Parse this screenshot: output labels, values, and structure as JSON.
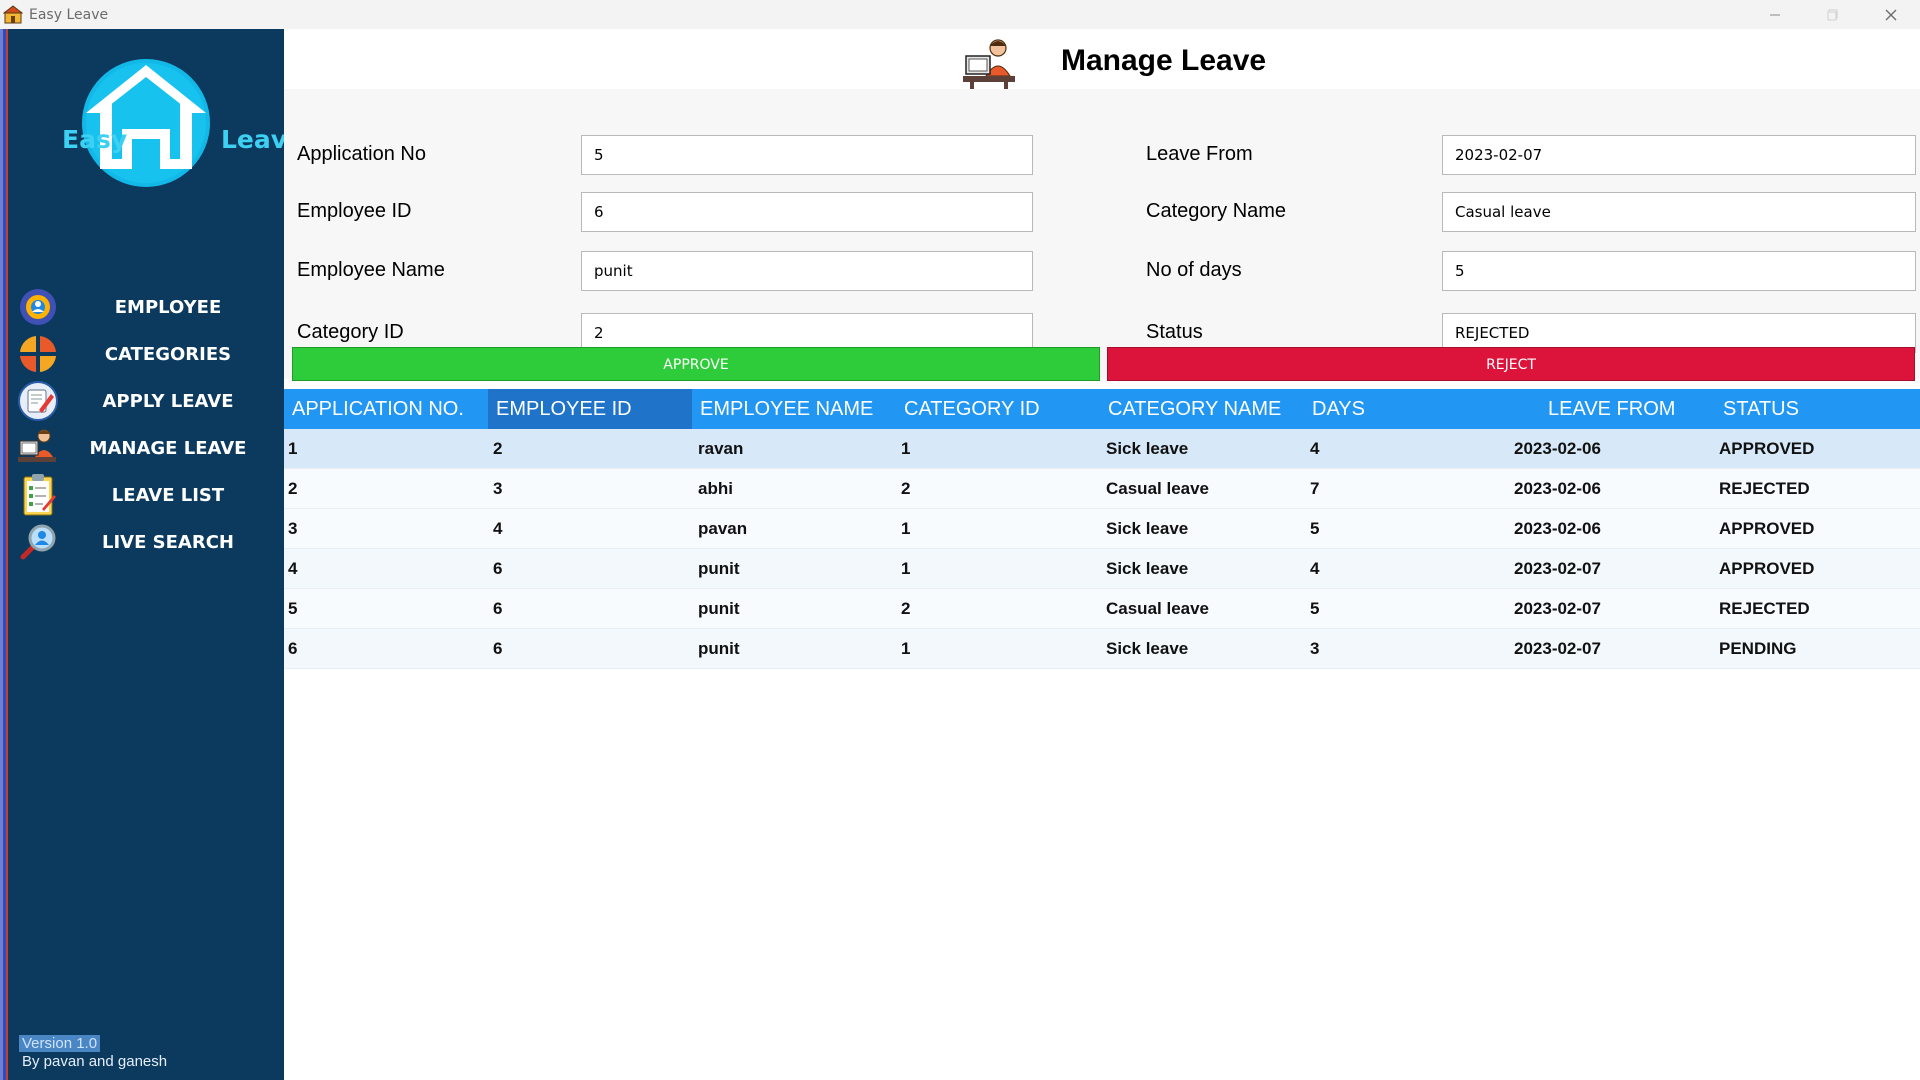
{
  "window": {
    "title": "Easy Leave",
    "controls": [
      "minimize-icon",
      "maximize-icon",
      "close-icon"
    ]
  },
  "sidebar": {
    "logo": {
      "left_text": "Easy",
      "right_text": "Leave",
      "icon": "house-icon",
      "color": "#3dd0f3"
    },
    "items": [
      {
        "label": "EMPLOYEE",
        "icon": "employee-gear-icon"
      },
      {
        "label": "CATEGORIES",
        "icon": "pie-chart-icon"
      },
      {
        "label": "APPLY LEAVE",
        "icon": "edit-document-icon"
      },
      {
        "label": "MANAGE LEAVE",
        "icon": "person-at-computer-icon"
      },
      {
        "label": "LEAVE LIST",
        "icon": "clipboard-list-icon"
      },
      {
        "label": "LIVE SEARCH",
        "icon": "magnifier-user-icon"
      }
    ],
    "version": "Version 1.0",
    "byline": "By pavan and ganesh",
    "bg_color": "#0b3a5e"
  },
  "header": {
    "title": "Manage Leave",
    "icon": "person-at-computer-icon"
  },
  "form": {
    "application_no": {
      "label": "Application No",
      "value": "5"
    },
    "employee_id": {
      "label": "Employee ID",
      "value": "6"
    },
    "employee_name": {
      "label": "Employee Name",
      "value": "punit"
    },
    "category_id": {
      "label": "Category ID",
      "value": "2"
    },
    "leave_from": {
      "label": "Leave From",
      "value": "2023-02-07"
    },
    "category_name": {
      "label": "Category Name",
      "value": "Casual leave"
    },
    "no_of_days": {
      "label": "No of days",
      "value": "5"
    },
    "status": {
      "label": "Status",
      "value": "REJECTED"
    }
  },
  "actions": {
    "approve": "APPROVE",
    "reject": "REJECT",
    "approve_color": "#2ecc3a",
    "reject_color": "#dc143c"
  },
  "table": {
    "header_color": "#2196f3",
    "columns": [
      "APPLICATION NO.",
      "EMPLOYEE ID",
      "EMPLOYEE NAME",
      "CATEGORY ID",
      "CATEGORY NAME",
      "DAYS",
      "LEAVE FROM",
      "STATUS"
    ],
    "rows": [
      [
        "1",
        "2",
        "ravan",
        "1",
        "Sick leave",
        "4",
        "2023-02-06",
        "APPROVED"
      ],
      [
        "2",
        "3",
        "abhi",
        "2",
        "Casual leave",
        "7",
        "2023-02-06",
        "REJECTED"
      ],
      [
        "3",
        "4",
        "pavan",
        "1",
        "Sick leave",
        "5",
        "2023-02-06",
        "APPROVED"
      ],
      [
        "4",
        "6",
        "punit",
        "1",
        "Sick leave",
        "4",
        "2023-02-07",
        "APPROVED"
      ],
      [
        "5",
        "6",
        "punit",
        "2",
        "Casual leave",
        "5",
        "2023-02-07",
        "REJECTED"
      ],
      [
        "6",
        "6",
        "punit",
        "1",
        "Sick leave",
        "3",
        "2023-02-07",
        "PENDING"
      ]
    ]
  }
}
